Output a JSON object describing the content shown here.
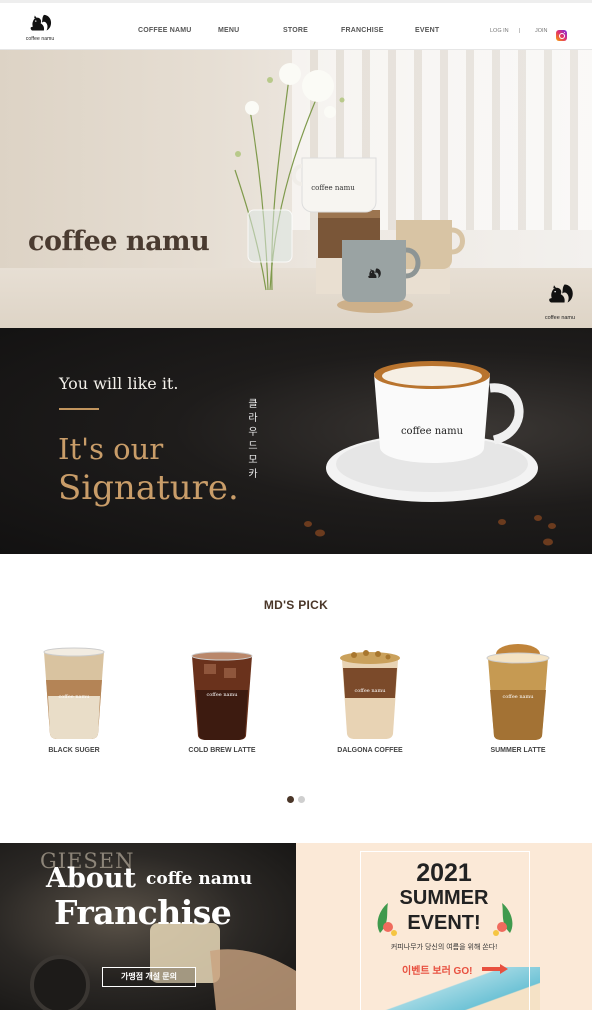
{
  "header": {
    "logo_text": "coffee namu",
    "nav": [
      "COFFEE NAMU",
      "MENU",
      "STORE",
      "FRANCHISE",
      "EVENT"
    ],
    "login": "LOG IN",
    "separator": "|",
    "join": "JOIN"
  },
  "hero": {
    "title": "coffee namu",
    "mug_text": "coffee namu",
    "corner_logo_text": "coffee namu"
  },
  "signature": {
    "subtitle": "You will like it.",
    "line1": "It's our",
    "line2": "Signature.",
    "korean_vertical": "클라우드 모카",
    "cup_text": "coffee namu"
  },
  "md_pick": {
    "title": "MD'S PICK",
    "products": [
      {
        "name": "BLACK SUGER",
        "cup_text": "coffee namu"
      },
      {
        "name": "COLD BREW LATTE",
        "cup_text": "coffee namu"
      },
      {
        "name": "DALGONA COFFEE",
        "cup_text": "coffee namu"
      },
      {
        "name": "SUMMER LATTE",
        "cup_text": "coffee namu"
      }
    ],
    "pagination": {
      "count": 2,
      "active": 1
    }
  },
  "franchise": {
    "bg_text": "GIESEN",
    "about": "About",
    "brand": "coffe namu",
    "word": "Franchise",
    "button": "가맹점 개설 문의"
  },
  "event": {
    "year": "2021",
    "summer": "SUMMER",
    "event": "EVENT!",
    "description": "커피나무가 당신의 여름을 위해 쏜다!",
    "cta": "이벤트 보러 GO!"
  },
  "colors": {
    "brand_brown": "#4a3628",
    "gold": "#c99d69",
    "cta_red": "#e8503f",
    "dot_active": "#4a3628",
    "dot_inactive": "#cfcfcf"
  }
}
